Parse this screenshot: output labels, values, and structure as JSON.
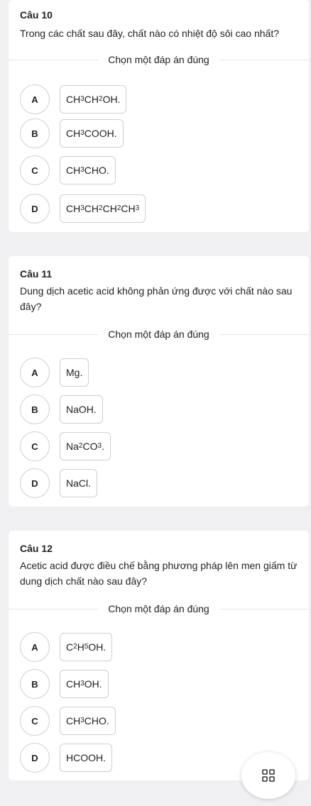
{
  "choose_label": "Chọn một đáp án đúng",
  "questions": [
    {
      "title": "Câu 10",
      "text": "Trong các chất sau đây, chất nào có nhiệt độ sôi cao nhất?",
      "options": [
        {
          "letter": "A",
          "html": "CH<sub>3</sub>CH<sub>2</sub>OH."
        },
        {
          "letter": "B",
          "html": "CH<sub>3</sub>COOH."
        },
        {
          "letter": "C",
          "html": "CH<sub>3</sub>CHO."
        },
        {
          "letter": "D",
          "html": "CH<sub>3</sub>CH<sub>2</sub>CH<sub>2</sub>CH<sub>3</sub>"
        }
      ]
    },
    {
      "title": "Câu 11",
      "text": "Dung dịch acetic acid không phản ứng được với chất nào sau đây?",
      "options": [
        {
          "letter": "A",
          "html": "Mg."
        },
        {
          "letter": "B",
          "html": "NaOH."
        },
        {
          "letter": "C",
          "html": "Na<sub>2</sub>CO<sub>3</sub>."
        },
        {
          "letter": "D",
          "html": "NaCl."
        }
      ]
    },
    {
      "title": "Câu 12",
      "text": "Acetic acid được điều chế bằng phương pháp lên men giấm từ dung dịch chất nào sau đây?",
      "options": [
        {
          "letter": "A",
          "html": "C<sub>2</sub>H<sub>5</sub>OH."
        },
        {
          "letter": "B",
          "html": "CH<sub>3</sub>OH."
        },
        {
          "letter": "C",
          "html": "CH<sub>3</sub>CHO."
        },
        {
          "letter": "D",
          "html": "HCOOH."
        }
      ]
    }
  ],
  "fab_icon": "grid-icon"
}
